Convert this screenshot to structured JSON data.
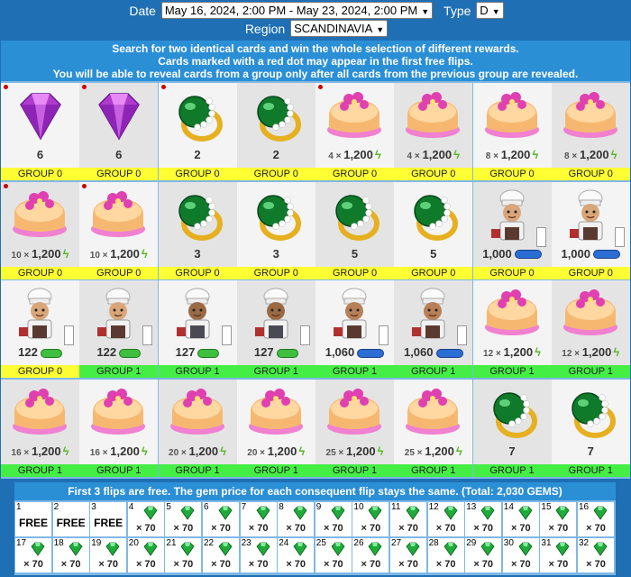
{
  "filters": {
    "date_label": "Date",
    "date_value": "May 16, 2024, 2:00 PM - May 23, 2024, 2:00 PM",
    "type_label": "Type",
    "type_value": "D",
    "region_label": "Region",
    "region_value": "SCANDINAVIA"
  },
  "info": {
    "line1": "Search for two identical cards and win the whole selection of different rewards.",
    "line2": "Cards marked with a red dot may appear in the first free flips.",
    "line3": "You will be able to reveal cards from a group only after all cards from the previous group are revealed."
  },
  "cards": [
    {
      "item": "purple-gem",
      "amount": "6",
      "group": "GROUP 0",
      "red": true
    },
    {
      "item": "purple-gem",
      "amount": "6",
      "group": "GROUP 0",
      "red": true
    },
    {
      "item": "green-ring",
      "amount": "2",
      "group": "GROUP 0",
      "red": true
    },
    {
      "item": "green-ring",
      "amount": "2",
      "group": "GROUP 0",
      "red": false
    },
    {
      "item": "cake",
      "mult": "4 ×",
      "amount": "1,200",
      "bolt": true,
      "group": "GROUP 0",
      "red": true
    },
    {
      "item": "cake",
      "mult": "4 ×",
      "amount": "1,200",
      "bolt": true,
      "group": "GROUP 0",
      "red": false
    },
    {
      "item": "cake",
      "mult": "8 ×",
      "amount": "1,200",
      "bolt": true,
      "group": "GROUP 0",
      "red": false
    },
    {
      "item": "cake",
      "mult": "8 ×",
      "amount": "1,200",
      "bolt": true,
      "group": "GROUP 0",
      "red": false
    },
    {
      "item": "cake",
      "mult": "10 ×",
      "amount": "1,200",
      "bolt": true,
      "group": "GROUP 0",
      "red": true
    },
    {
      "item": "cake",
      "mult": "10 ×",
      "amount": "1,200",
      "bolt": true,
      "group": "GROUP 0",
      "red": true
    },
    {
      "item": "green-ring",
      "amount": "3",
      "group": "GROUP 0",
      "red": false
    },
    {
      "item": "green-ring",
      "amount": "3",
      "group": "GROUP 0",
      "red": false
    },
    {
      "item": "green-ring",
      "amount": "5",
      "group": "GROUP 0",
      "red": false
    },
    {
      "item": "green-ring",
      "amount": "5",
      "group": "GROUP 0",
      "red": false
    },
    {
      "item": "chef",
      "amount": "1,000",
      "pill": "blue",
      "box": true,
      "group": "GROUP 0",
      "red": false
    },
    {
      "item": "chef",
      "amount": "1,000",
      "pill": "blue",
      "box": true,
      "group": "GROUP 0",
      "red": false
    },
    {
      "item": "chef",
      "amount": "122",
      "pill": "green",
      "box": true,
      "group": "GROUP 0",
      "red": false
    },
    {
      "item": "chef",
      "amount": "122",
      "pill": "green",
      "box": true,
      "group": "GROUP 1",
      "red": false
    },
    {
      "item": "chef-f",
      "amount": "127",
      "pill": "green",
      "box": true,
      "group": "GROUP 1",
      "red": false
    },
    {
      "item": "chef-f",
      "amount": "127",
      "pill": "green",
      "box": true,
      "group": "GROUP 1",
      "red": false
    },
    {
      "item": "chef-m",
      "amount": "1,060",
      "pill": "blue",
      "box": true,
      "group": "GROUP 1",
      "red": false
    },
    {
      "item": "chef-m",
      "amount": "1,060",
      "pill": "blue",
      "box": true,
      "group": "GROUP 1",
      "red": false
    },
    {
      "item": "cake",
      "mult": "12 ×",
      "amount": "1,200",
      "bolt": true,
      "group": "GROUP 1",
      "red": false
    },
    {
      "item": "cake",
      "mult": "12 ×",
      "amount": "1,200",
      "bolt": true,
      "group": "GROUP 1",
      "red": false
    },
    {
      "item": "cake",
      "mult": "16 ×",
      "amount": "1,200",
      "bolt": true,
      "group": "GROUP 1",
      "red": false
    },
    {
      "item": "cake",
      "mult": "16 ×",
      "amount": "1,200",
      "bolt": true,
      "group": "GROUP 1",
      "red": false
    },
    {
      "item": "cake",
      "mult": "20 ×",
      "amount": "1,200",
      "bolt": true,
      "group": "GROUP 1",
      "red": false
    },
    {
      "item": "cake",
      "mult": "20 ×",
      "amount": "1,200",
      "bolt": true,
      "group": "GROUP 1",
      "red": false
    },
    {
      "item": "cake",
      "mult": "25 ×",
      "amount": "1,200",
      "bolt": true,
      "group": "GROUP 1",
      "red": false
    },
    {
      "item": "cake",
      "mult": "25 ×",
      "amount": "1,200",
      "bolt": true,
      "group": "GROUP 1",
      "red": false
    },
    {
      "item": "green-ring",
      "amount": "7",
      "group": "GROUP 1",
      "red": false
    },
    {
      "item": "green-ring",
      "amount": "7",
      "group": "GROUP 1",
      "red": false
    }
  ],
  "prices": {
    "title": "First 3 flips are free. The gem price for each consequent flip stays the same. (Total: 2,030 GEMS)",
    "slots": [
      {
        "n": "1",
        "free": "FREE"
      },
      {
        "n": "2",
        "free": "FREE"
      },
      {
        "n": "3",
        "free": "FREE"
      },
      {
        "n": "4",
        "cost": "× 70"
      },
      {
        "n": "5",
        "cost": "× 70"
      },
      {
        "n": "6",
        "cost": "× 70"
      },
      {
        "n": "7",
        "cost": "× 70"
      },
      {
        "n": "8",
        "cost": "× 70"
      },
      {
        "n": "9",
        "cost": "× 70"
      },
      {
        "n": "10",
        "cost": "× 70"
      },
      {
        "n": "11",
        "cost": "× 70"
      },
      {
        "n": "12",
        "cost": "× 70"
      },
      {
        "n": "13",
        "cost": "× 70"
      },
      {
        "n": "14",
        "cost": "× 70"
      },
      {
        "n": "15",
        "cost": "× 70"
      },
      {
        "n": "16",
        "cost": "× 70"
      },
      {
        "n": "17",
        "cost": "× 70"
      },
      {
        "n": "18",
        "cost": "× 70"
      },
      {
        "n": "19",
        "cost": "× 70"
      },
      {
        "n": "20",
        "cost": "× 70"
      },
      {
        "n": "21",
        "cost": "× 70"
      },
      {
        "n": "22",
        "cost": "× 70"
      },
      {
        "n": "23",
        "cost": "× 70"
      },
      {
        "n": "24",
        "cost": "× 70"
      },
      {
        "n": "25",
        "cost": "× 70"
      },
      {
        "n": "26",
        "cost": "× 70"
      },
      {
        "n": "27",
        "cost": "× 70"
      },
      {
        "n": "28",
        "cost": "× 70"
      },
      {
        "n": "29",
        "cost": "× 70"
      },
      {
        "n": "30",
        "cost": "× 70"
      },
      {
        "n": "31",
        "cost": "× 70"
      },
      {
        "n": "32",
        "cost": "× 70"
      }
    ]
  },
  "colors": {
    "header_bg": "#2b8fd6",
    "group0": "#ffff33",
    "group1": "#44ee44",
    "board_bg": "#7fb8e6"
  }
}
